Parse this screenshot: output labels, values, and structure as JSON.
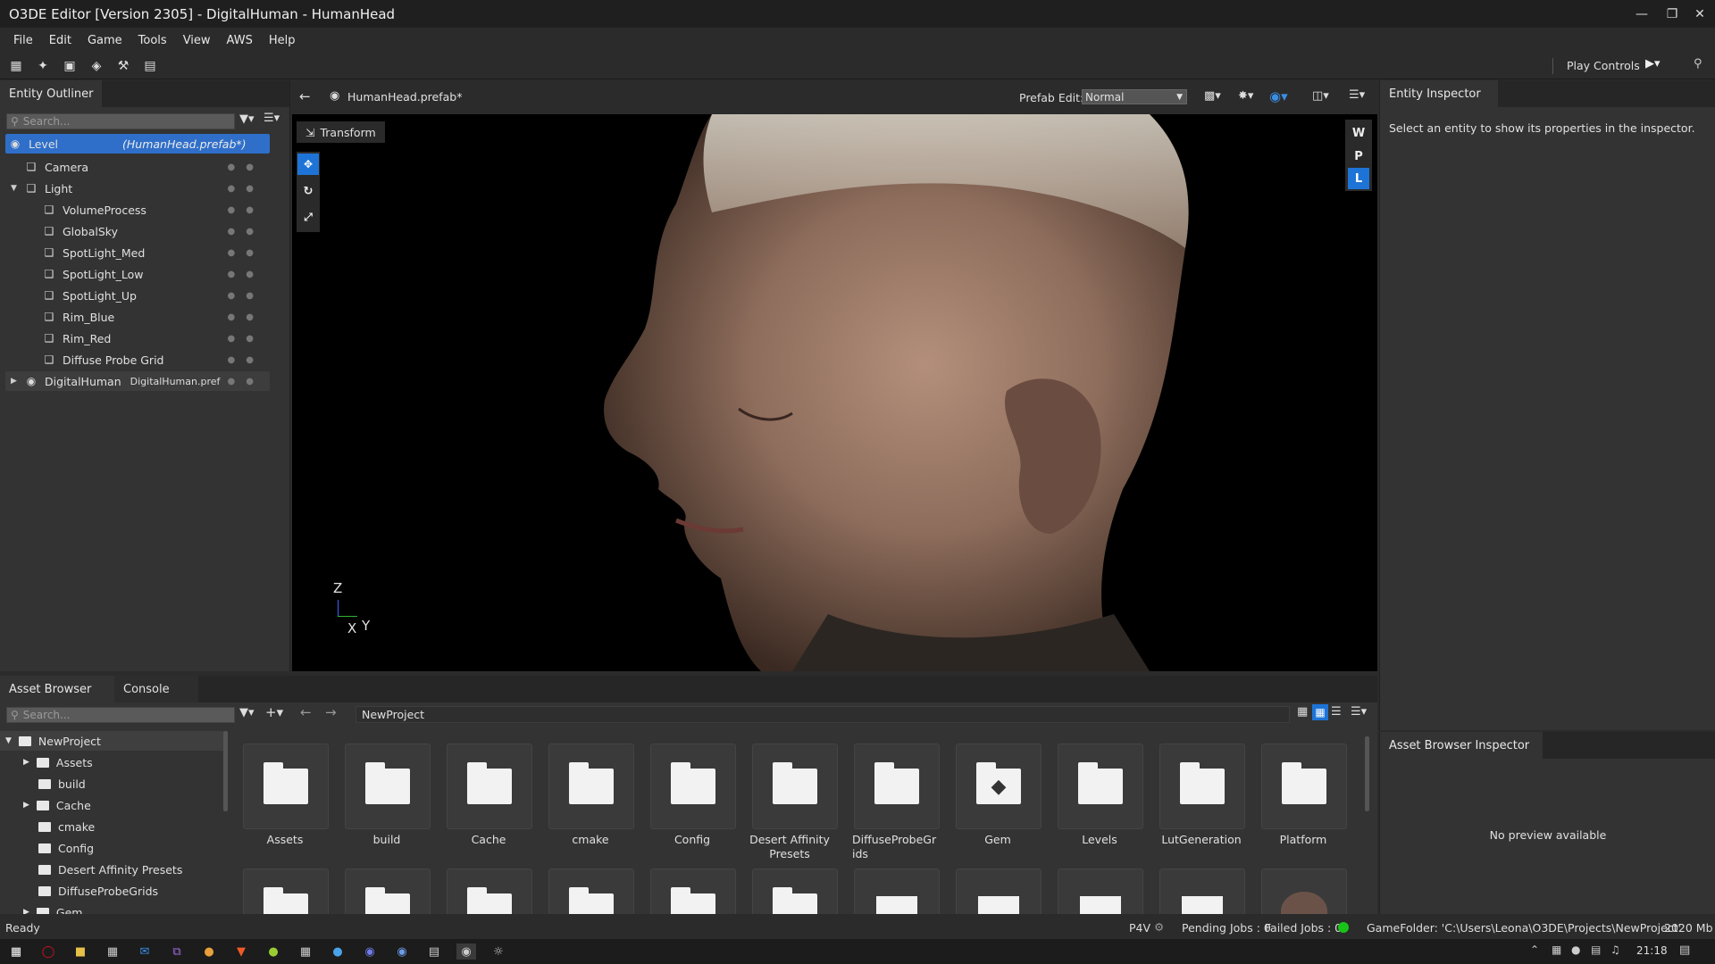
{
  "window": {
    "title": "O3DE Editor [Version 2305] - DigitalHuman - HumanHead"
  },
  "menu": [
    "File",
    "Edit",
    "Game",
    "Tools",
    "View",
    "AWS",
    "Help"
  ],
  "toolbar": {
    "play_controls": "Play Controls"
  },
  "outliner": {
    "tab": "Entity Outliner",
    "search_placeholder": "Search...",
    "level": {
      "label": "Level",
      "prefab": "(HumanHead.prefab*)"
    },
    "items": [
      {
        "label": "Camera"
      },
      {
        "label": "Light"
      },
      {
        "label": "VolumeProcess"
      },
      {
        "label": "GlobalSky"
      },
      {
        "label": "SpotLight_Med"
      },
      {
        "label": "SpotLight_Low"
      },
      {
        "label": "SpotLight_Up"
      },
      {
        "label": "Rim_Blue"
      },
      {
        "label": "Rim_Red"
      },
      {
        "label": "Diffuse Probe Grid"
      }
    ],
    "digital_human": {
      "label": "DigitalHuman",
      "prefab": "DigitalHuman.pref"
    }
  },
  "viewport": {
    "prefab_tab": "HumanHead.prefab*",
    "prefab_edit_label": "Prefab Edit:",
    "prefab_edit_value": "Normal",
    "transform_label": "Transform",
    "space_buttons": [
      "W",
      "P",
      "L"
    ],
    "axis": {
      "z": "Z",
      "x": "X",
      "y": "Y"
    }
  },
  "inspector": {
    "tab": "Entity Inspector",
    "message": "Select an entity to show its properties in the inspector."
  },
  "asset_browser": {
    "tabs": [
      "Asset Browser",
      "Console"
    ],
    "search_placeholder": "Search...",
    "path": "NewProject",
    "tree": [
      {
        "label": "NewProject"
      },
      {
        "label": "Assets"
      },
      {
        "label": "build"
      },
      {
        "label": "Cache"
      },
      {
        "label": "cmake"
      },
      {
        "label": "Config"
      },
      {
        "label": "Desert Affinity Presets"
      },
      {
        "label": "DiffuseProbeGrids"
      },
      {
        "label": "Gem"
      }
    ],
    "tiles": [
      {
        "label": "Assets",
        "icon": "folder-icon"
      },
      {
        "label": "build",
        "icon": "folder-icon"
      },
      {
        "label": "Cache",
        "icon": "folder-icon"
      },
      {
        "label": "cmake",
        "icon": "folder-icon"
      },
      {
        "label": "Config",
        "icon": "folder-icon"
      },
      {
        "label": "Desert Affinity Presets",
        "icon": "folder-icon"
      },
      {
        "label": "DiffuseProbeGrids",
        "icon": "folder-icon"
      },
      {
        "label": "Gem",
        "icon": "gem-icon"
      },
      {
        "label": "Levels",
        "icon": "folder-icon"
      },
      {
        "label": "LutGeneration",
        "icon": "folder-icon"
      },
      {
        "label": "Platform",
        "icon": "folder-icon"
      }
    ]
  },
  "ab_inspector": {
    "tab": "Asset Browser Inspector",
    "message": "No preview available"
  },
  "status": {
    "ready": "Ready",
    "p4v": "P4V",
    "pending": "Pending Jobs : 0",
    "failed": "Failed Jobs : 0",
    "gamefolder": "GameFolder: 'C:\\Users\\Leona\\O3DE\\Projects\\NewProject'",
    "memory": "2020 Mb"
  },
  "taskbar": {
    "time": "21:18"
  },
  "colors": {
    "accent": "#1e74d6",
    "selection": "#2f6fc9",
    "status_ok": "#18c418"
  }
}
